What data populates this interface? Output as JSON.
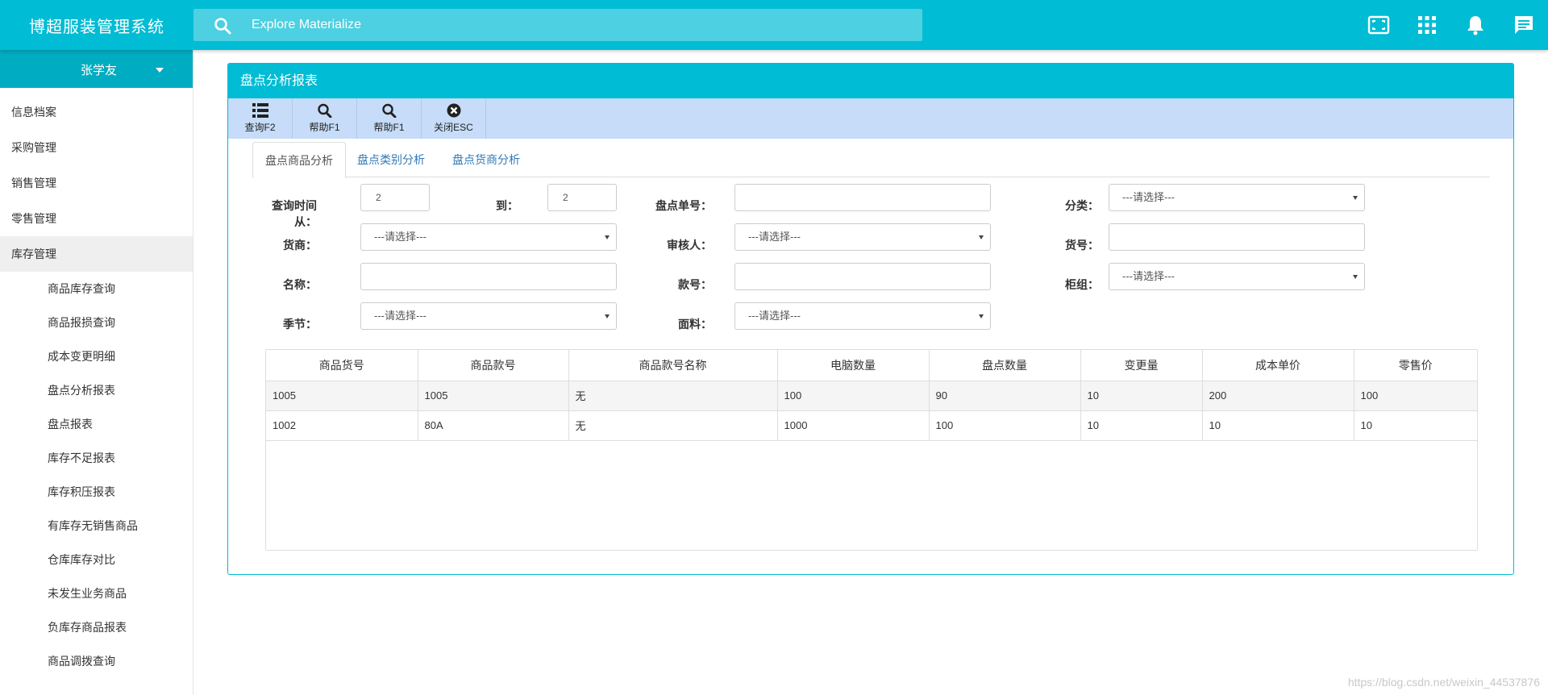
{
  "app": {
    "title": "博超服装管理系统"
  },
  "search": {
    "placeholder": "Explore Materialize"
  },
  "top_icons": [
    "fullscreen-icon",
    "apps-grid-icon",
    "bell-icon",
    "chat-icon"
  ],
  "user": {
    "name": "张学友"
  },
  "menu": {
    "items": [
      {
        "label": "信息档案"
      },
      {
        "label": "采购管理"
      },
      {
        "label": "销售管理"
      },
      {
        "label": "零售管理"
      },
      {
        "label": "库存管理"
      }
    ],
    "submenu": [
      {
        "label": "商品库存查询"
      },
      {
        "label": "商品报损查询"
      },
      {
        "label": "成本变更明细"
      },
      {
        "label": "盘点分析报表"
      },
      {
        "label": "盘点报表"
      },
      {
        "label": "库存不足报表"
      },
      {
        "label": "库存积压报表"
      },
      {
        "label": "有库存无销售商品"
      },
      {
        "label": "仓库库存对比"
      },
      {
        "label": "未发生业务商品"
      },
      {
        "label": "负库存商品报表"
      },
      {
        "label": "商品调拨查询"
      }
    ]
  },
  "panel": {
    "title": "盘点分析报表"
  },
  "toolbar": {
    "query_label": "查询F2",
    "help_label": "帮助F1",
    "help2_label": "帮助F1",
    "close_label": "关闭ESC"
  },
  "tabs": [
    {
      "label": "盘点商品分析"
    },
    {
      "label": "盘点类别分析"
    },
    {
      "label": "盘点货商分析"
    }
  ],
  "form": {
    "time_from_label": "查询时间从：",
    "time_from_value": "2",
    "time_to_label": "到：",
    "time_to_value": "2",
    "order_no_label": "盘点单号：",
    "category_label": "分类：",
    "category_value": "---请选择---",
    "vendor_label": "货商：",
    "vendor_value": "---请选择---",
    "reviewer_label": "审核人：",
    "reviewer_value": "---请选择---",
    "item_no_label": "货号：",
    "name_label": "名称：",
    "style_no_label": "款号：",
    "counter_label": "柜组：",
    "counter_value": "---请选择---",
    "season_label": "季节：",
    "season_value": "---请选择---",
    "fabric_label": "面料：",
    "fabric_value": "---请选择---"
  },
  "table": {
    "columns": [
      "商品货号",
      "商品款号",
      "商品款号名称",
      "电脑数量",
      "盘点数量",
      "变更量",
      "成本单价",
      "零售价"
    ],
    "rows": [
      [
        "1005",
        "1005",
        "无",
        "100",
        "90",
        "10",
        "200",
        "100"
      ],
      [
        "1002",
        "80A",
        "无",
        "1000",
        "100",
        "10",
        "10",
        "10"
      ]
    ]
  },
  "watermark": "https://blog.csdn.net/weixin_44537876"
}
